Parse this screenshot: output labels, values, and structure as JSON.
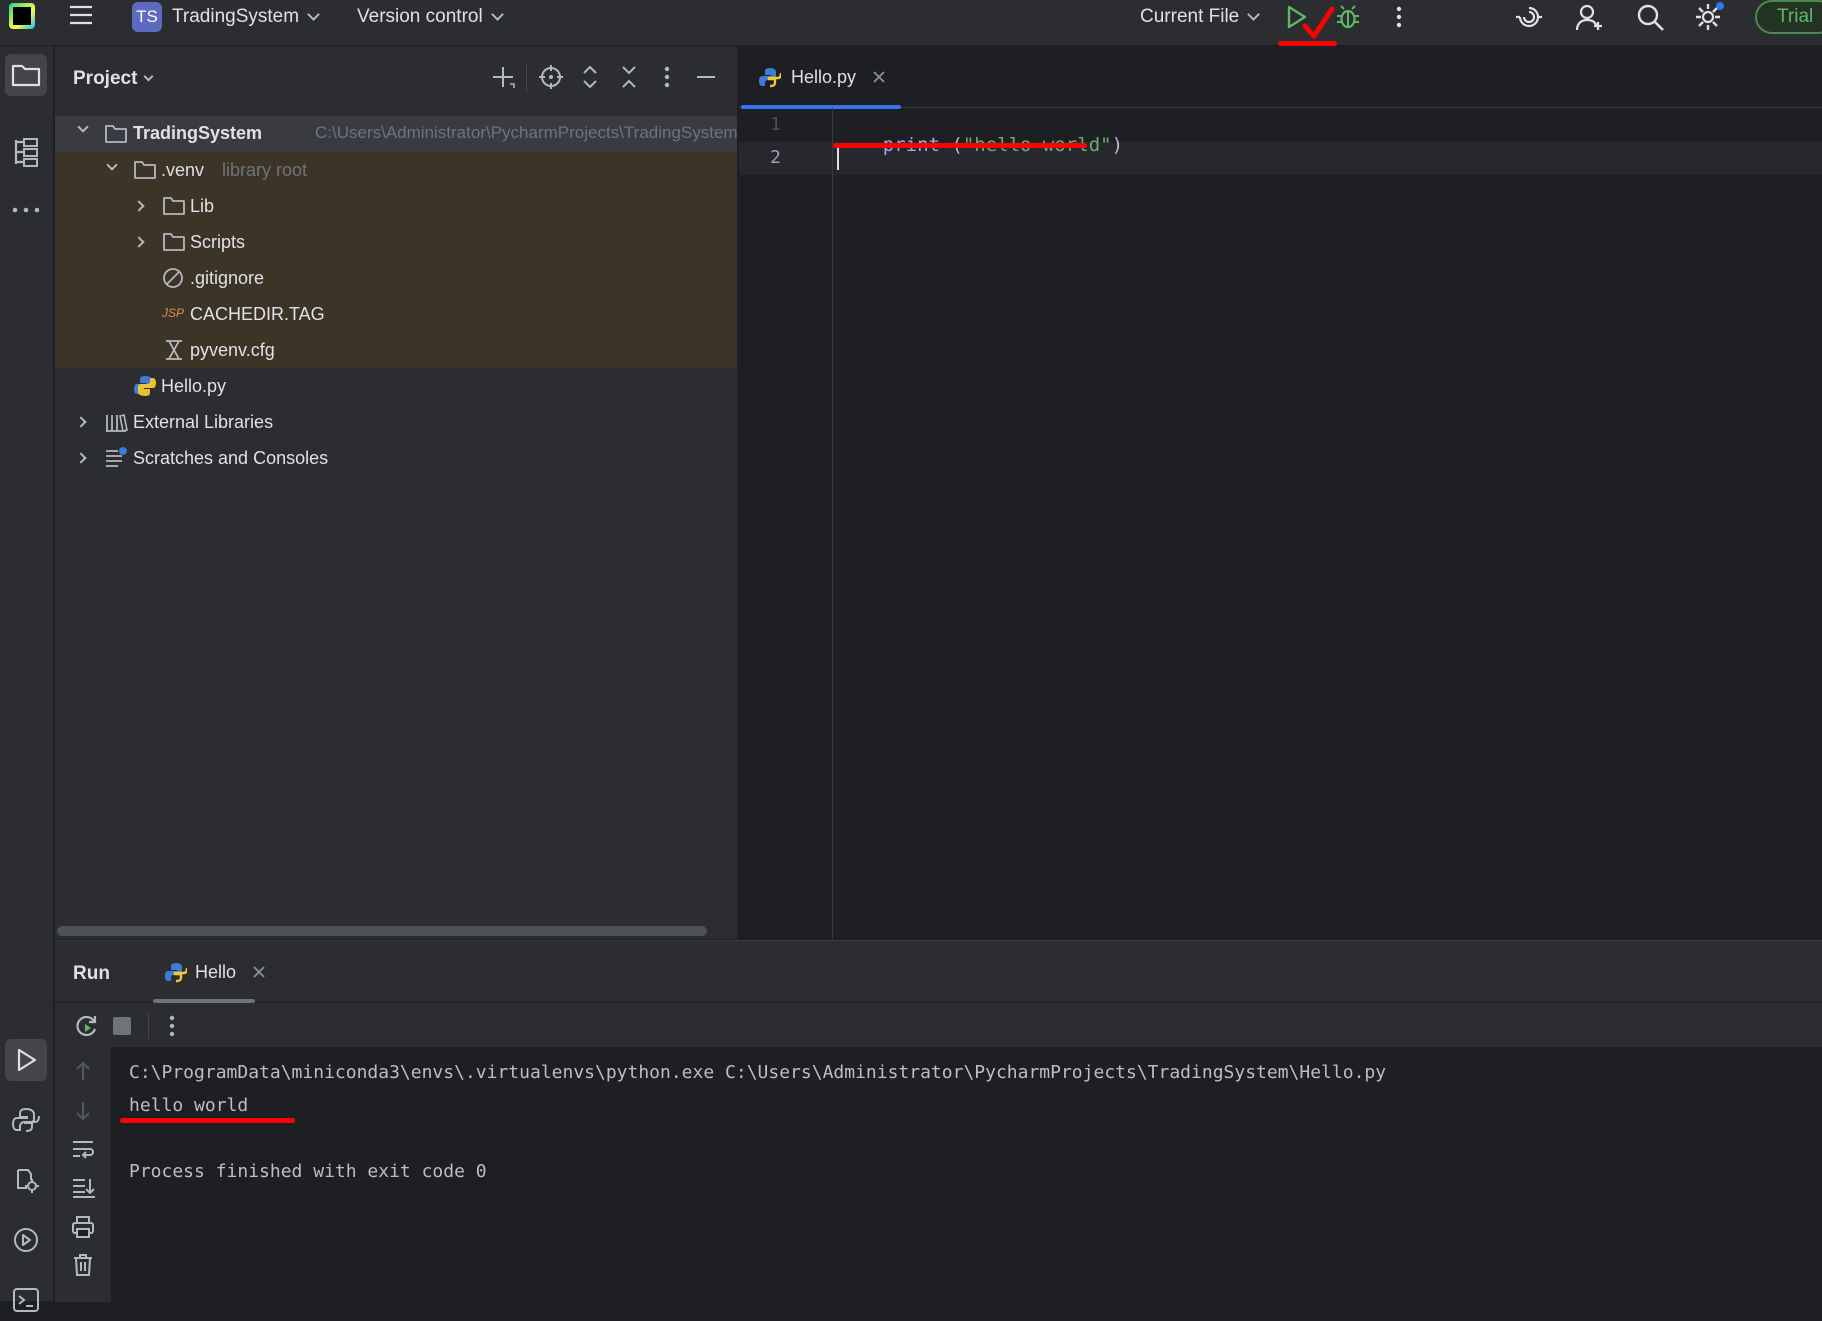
{
  "titlebar": {
    "project_badge": "TS",
    "project_name": "TradingSystem",
    "vcs_label": "Version control",
    "run_config": "Current File",
    "trial_label": "Trial"
  },
  "project_panel": {
    "title": "Project",
    "tree": {
      "root_name": "TradingSystem",
      "root_path": "C:\\Users\\Administrator\\PycharmProjects\\TradingSystem",
      "venv_name": ".venv",
      "venv_hint": "library root",
      "lib": "Lib",
      "scripts": "Scripts",
      "gitignore": ".gitignore",
      "cachedir": "CACHEDIR.TAG",
      "cachedir_badge": "JSP",
      "pyvenv": "pyvenv.cfg",
      "hello": "Hello.py",
      "external_libraries": "External Libraries",
      "scratches": "Scratches and Consoles"
    }
  },
  "editor": {
    "tab_label": "Hello.py",
    "line_numbers": [
      "1",
      "2"
    ],
    "code": {
      "keyword": "print",
      "space_paren": " (",
      "string": "\"hello world\"",
      "close_paren": ")"
    }
  },
  "run_panel": {
    "title": "Run",
    "tab_label": "Hello",
    "console": {
      "command": "C:\\ProgramData\\miniconda3\\envs\\.virtualenvs\\python.exe C:\\Users\\Administrator\\PycharmProjects\\TradingSystem\\Hello.py",
      "output": "hello world",
      "finish": "Process finished with exit code 0"
    }
  },
  "colors": {
    "accent_blue": "#3574f0",
    "run_green": "#5fb865",
    "annotation_red": "#ff0000",
    "venv_highlight": "#3d3428"
  }
}
